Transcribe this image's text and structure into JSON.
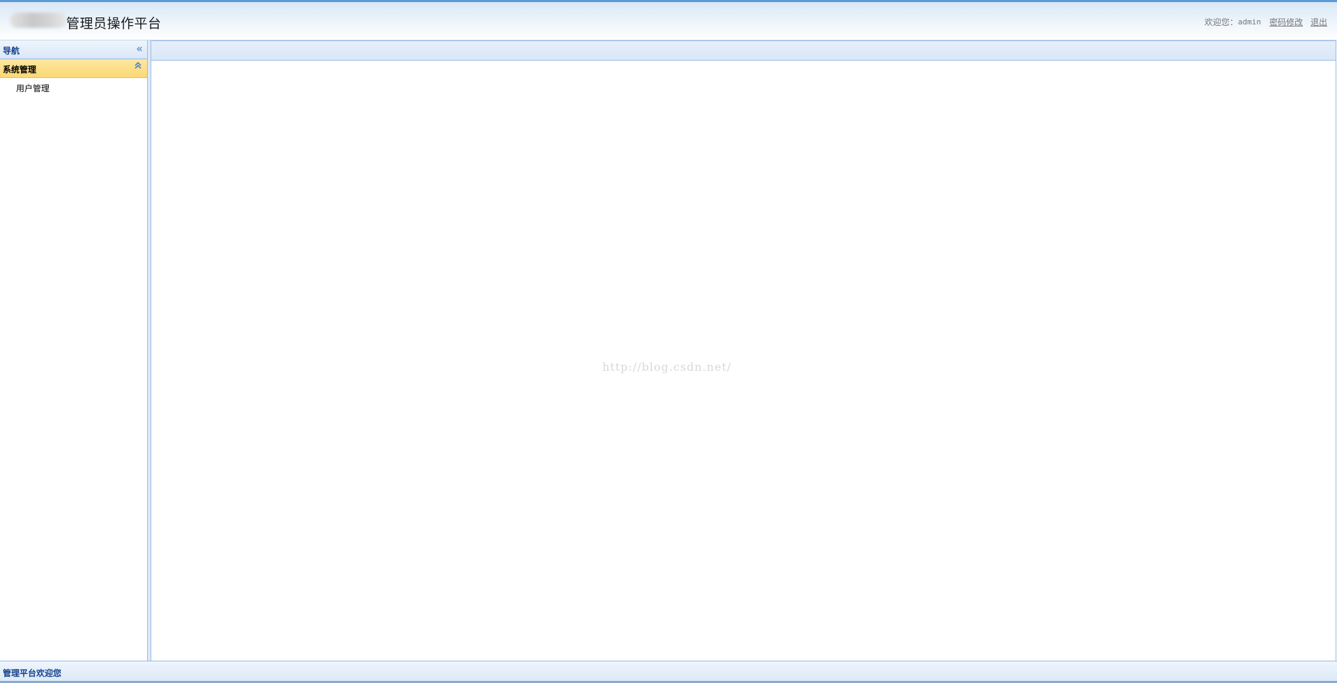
{
  "header": {
    "title": "管理员操作平台",
    "welcome_label": "欢迎您：",
    "username": "admin",
    "change_password_link": "密码修改",
    "logout_link": "退出"
  },
  "sidebar": {
    "nav_title": "导航",
    "collapse_icon": "double-chevron-left-icon",
    "group": {
      "label": "系统管理",
      "fold_icon": "double-chevron-up-icon",
      "items": [
        {
          "label": "用户管理"
        }
      ]
    }
  },
  "main": {
    "watermark": "http://blog.csdn.net/"
  },
  "footer": {
    "status_text": "管理平台欢迎您"
  },
  "colors": {
    "header_top_border": "#5a9bd5",
    "panel_border": "#99bbe8",
    "nav_title_text": "#15428b",
    "group_header_bg": "#fbd874"
  }
}
